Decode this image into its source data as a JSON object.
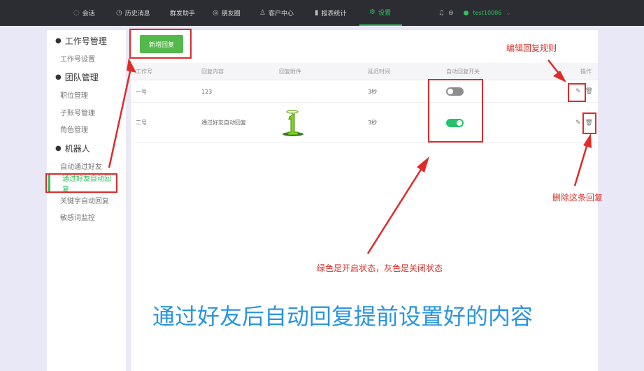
{
  "nav": {
    "items": [
      {
        "icon": "chat-icon",
        "glyph": "◌",
        "label": "会话"
      },
      {
        "icon": "history-icon",
        "glyph": "◷",
        "label": "历史消息"
      },
      {
        "icon": "",
        "glyph": "",
        "label": "群发助手"
      },
      {
        "icon": "moments-icon",
        "glyph": "◎",
        "label": "朋友圈"
      },
      {
        "icon": "customer-icon",
        "glyph": "♙",
        "label": "客户中心"
      },
      {
        "icon": "stats-icon",
        "glyph": "▮",
        "label": "报表统计"
      },
      {
        "icon": "settings-icon",
        "glyph": "⚙",
        "label": "设置"
      }
    ],
    "username": "test10086"
  },
  "sidebar": {
    "groups": [
      {
        "title": "工作号管理",
        "icon": "wechat-icon",
        "glyph": "●",
        "items": [
          "工作号设置"
        ]
      },
      {
        "title": "团队管理",
        "icon": "team-icon",
        "glyph": "●",
        "items": [
          "职位管理",
          "子账号管理",
          "角色管理"
        ]
      },
      {
        "title": "机器人",
        "icon": "robot-icon",
        "glyph": "●",
        "items": [
          "自动通过好友",
          "通过好友自动回复",
          "关键字自动回复",
          "敏感词监控"
        ]
      }
    ],
    "active_item": "通过好友自动回复"
  },
  "toolbar": {
    "add_label": "新增回复"
  },
  "table": {
    "headers": [
      "工作号",
      "回复内容",
      "回复附件",
      "延迟时间",
      "自动回复开关",
      "操作"
    ],
    "rows": [
      {
        "account": "一号",
        "content": "123",
        "attachment": "",
        "delay": "3秒",
        "enabled": false
      },
      {
        "account": "二号",
        "content": "通过好友自动回复",
        "attachment": "image",
        "delay": "3秒",
        "enabled": true
      }
    ]
  },
  "annotations": {
    "edit_rule": "编辑回复规则",
    "delete_rule": "删除这条回复",
    "toggle_note": "绿色是开启状态，灰色是关闭状态",
    "caption": "通过好友后自动回复提前设置好的内容"
  },
  "colors": {
    "accent": "#2fc25b",
    "button": "#53b94a",
    "toggle_on": "#23c26b",
    "toggle_off": "#8c8c8c",
    "annotation": "#d8322a",
    "caption": "#2a95e0"
  }
}
